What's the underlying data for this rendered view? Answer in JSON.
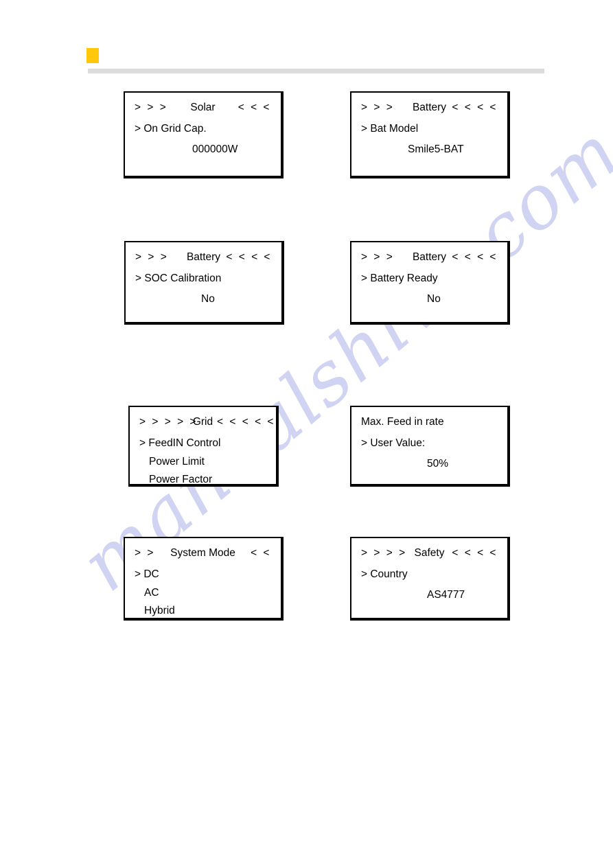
{
  "page": {
    "watermark": "manualshive.com",
    "header": {
      "marker_color": "#FFC80A",
      "rule_color": "#DCDCDC"
    }
  },
  "panels": [
    {
      "id": "solar-on-grid-cap",
      "arrows_left": "> > >",
      "title": "Solar",
      "arrows_right": "< < <",
      "lines": [
        {
          "kind": "selected",
          "text": "> On Grid Cap."
        },
        {
          "kind": "value",
          "text": "000000W"
        }
      ]
    },
    {
      "id": "battery-bat-model",
      "arrows_left": "> > >",
      "title": "Battery",
      "arrows_right": "< < < <",
      "lines": [
        {
          "kind": "selected",
          "text": "> Bat Model"
        },
        {
          "kind": "value",
          "text": "Smile5-BAT"
        }
      ]
    },
    {
      "id": "battery-soc-calibration",
      "arrows_left": "> > >",
      "title": "Battery",
      "arrows_right": "< < < <",
      "lines": [
        {
          "kind": "selected",
          "text": "> SOC Calibration"
        },
        {
          "kind": "value",
          "text": "No"
        }
      ]
    },
    {
      "id": "battery-battery-ready",
      "arrows_left": "> > >",
      "title": "Battery",
      "arrows_right": "< < < <",
      "lines": [
        {
          "kind": "selected",
          "text": "> Battery Ready"
        },
        {
          "kind": "value",
          "text": "No"
        }
      ]
    },
    {
      "id": "grid-feedin-control",
      "arrows_left": "> > > > >",
      "title": "Grid",
      "arrows_right": "< < < < <",
      "lines": [
        {
          "kind": "selected",
          "text": "> FeedIN Control"
        },
        {
          "kind": "option",
          "text": "Power Limit"
        },
        {
          "kind": "option",
          "text": "Power Factor"
        }
      ]
    },
    {
      "id": "max-feed-in-rate",
      "plain_title": "Max. Feed in rate",
      "lines": [
        {
          "kind": "selected",
          "text": "> User Value:"
        },
        {
          "kind": "value",
          "text": "50%"
        }
      ]
    },
    {
      "id": "system-mode",
      "arrows_left": "> >",
      "title": "System Mode",
      "arrows_right": "< <",
      "lines": [
        {
          "kind": "selected",
          "text": "> DC"
        },
        {
          "kind": "option",
          "text": "AC"
        },
        {
          "kind": "option",
          "text": "Hybrid"
        }
      ]
    },
    {
      "id": "safety-country",
      "arrows_left": "> > > >",
      "title": "Safety",
      "arrows_right": "< < < <",
      "lines": [
        {
          "kind": "selected",
          "text": "> Country"
        },
        {
          "kind": "value",
          "text": "AS4777"
        }
      ]
    }
  ]
}
